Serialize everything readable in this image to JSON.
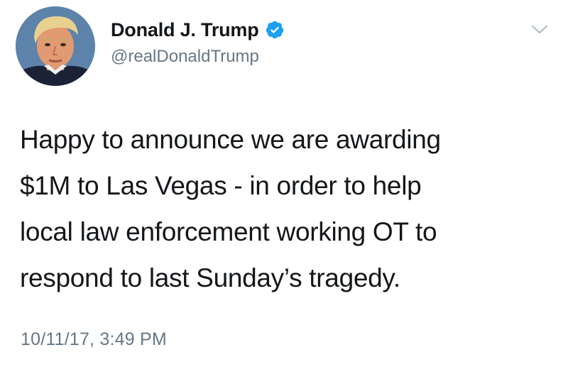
{
  "author": {
    "display_name": "Donald J. Trump",
    "handle": "@realDonaldTrump",
    "verified": true,
    "avatar_icon": "profile-photo",
    "verified_icon": "verified-badge-icon"
  },
  "tweet": {
    "text_lines": [
      "Happy to announce we are awarding",
      "$1M to Las Vegas - in order to help",
      "local law enforcement working OT to",
      "respond to last Sunday’s tragedy."
    ],
    "timestamp": "10/11/17, 3:49 PM"
  },
  "menu": {
    "caret_icon": "chevron-down-icon"
  },
  "colors": {
    "text_primary": "#14171a",
    "text_secondary": "#657786",
    "verified_blue": "#1da1f2",
    "background": "#ffffff"
  }
}
